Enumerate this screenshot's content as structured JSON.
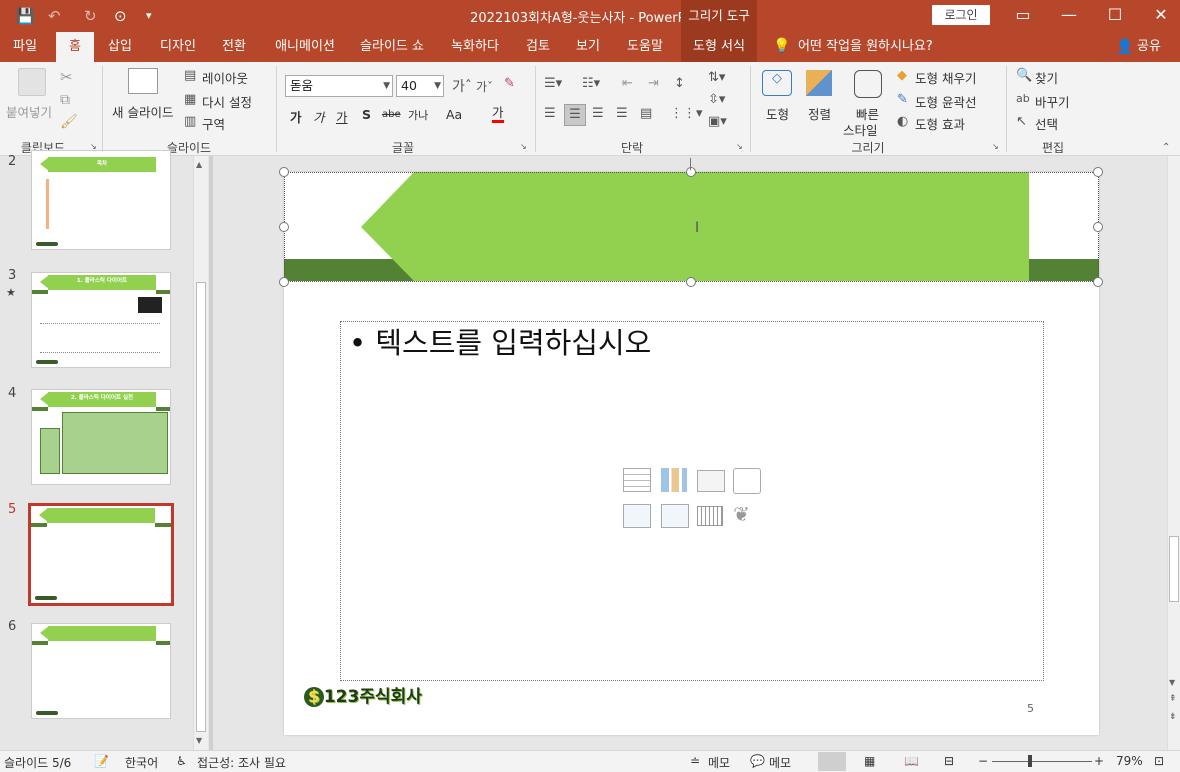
{
  "window": {
    "doc_title": "2022103회차A형-웃는사자  -  PowerPoint",
    "context_tool": "그리기 도구",
    "login": "로그인"
  },
  "tabs": [
    "파일",
    "홈",
    "삽입",
    "디자인",
    "전환",
    "애니메이션",
    "슬라이드 쇼",
    "녹화하다",
    "검토",
    "보기",
    "도움말",
    "도형 서식"
  ],
  "active_tab": "홈",
  "tell_me": "어떤 작업을 원하시나요?",
  "share": "공유",
  "ribbon": {
    "clipboard": {
      "paste": "붙여넣기",
      "label": "클립보드"
    },
    "slides": {
      "new_slide_line1": "새 슬라이드",
      "layout": "레이아웃",
      "reset": "다시 설정",
      "section": "구역",
      "label": "슬라이드"
    },
    "font": {
      "name": "돋움",
      "size": "40",
      "label": "글꼴",
      "bold": "가",
      "italic": "가",
      "underline": "가",
      "shadow": "S",
      "strike": "abe",
      "spacing": "가나",
      "case": "Aa",
      "color": "가"
    },
    "paragraph": {
      "label": "단락"
    },
    "drawing": {
      "shape": "도형",
      "arrange": "정렬",
      "quick_style_1": "빠른",
      "quick_style_2": "스타일",
      "fill": "도형 채우기",
      "outline": "도형 윤곽선",
      "effects": "도형 효과",
      "label": "그리기"
    },
    "editing": {
      "find": "찾기",
      "replace": "바꾸기",
      "select": "선택",
      "label": "편집"
    }
  },
  "thumbnails": [
    {
      "num": "2",
      "title": "목차",
      "star": ""
    },
    {
      "num": "3",
      "title": "1. 플라스틱 다이어트",
      "star": "★"
    },
    {
      "num": "4",
      "title": "2. 플라스틱 다이어트 실천",
      "star": ""
    },
    {
      "num": "5",
      "title": "",
      "star": ""
    },
    {
      "num": "6",
      "title": "",
      "star": ""
    }
  ],
  "slide": {
    "placeholder": "텍스트를 입력하십시오",
    "page_number": "5",
    "logo_text": "123주식회사"
  },
  "status": {
    "slide": "슬라이드 5/6",
    "lang": "한국어",
    "access": "접근성: 조사 필요",
    "notes": "메모",
    "comments": "메모",
    "zoom": "79%"
  },
  "colors": {
    "accent": "#b7472a",
    "green": "#92d050",
    "dark_green": "#548235"
  }
}
